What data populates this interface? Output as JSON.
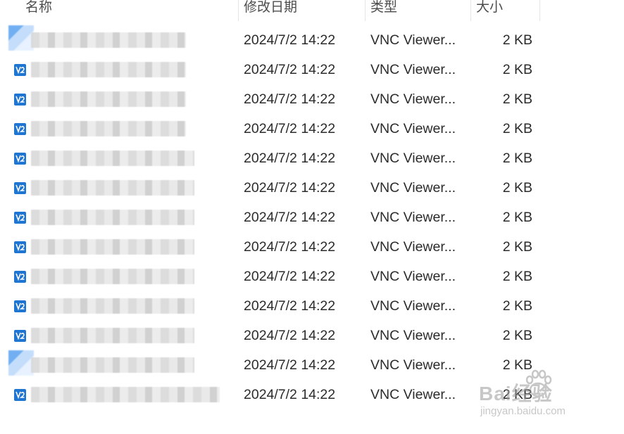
{
  "columns": {
    "name": "名称",
    "date": "修改日期",
    "type": "类型",
    "size": "大小"
  },
  "files": [
    {
      "date": "2024/7/2 14:22",
      "type": "VNC Viewer...",
      "size": "2 KB"
    },
    {
      "date": "2024/7/2 14:22",
      "type": "VNC Viewer...",
      "size": "2 KB"
    },
    {
      "date": "2024/7/2 14:22",
      "type": "VNC Viewer...",
      "size": "2 KB"
    },
    {
      "date": "2024/7/2 14:22",
      "type": "VNC Viewer...",
      "size": "2 KB"
    },
    {
      "date": "2024/7/2 14:22",
      "type": "VNC Viewer...",
      "size": "2 KB"
    },
    {
      "date": "2024/7/2 14:22",
      "type": "VNC Viewer...",
      "size": "2 KB"
    },
    {
      "date": "2024/7/2 14:22",
      "type": "VNC Viewer...",
      "size": "2 KB"
    },
    {
      "date": "2024/7/2 14:22",
      "type": "VNC Viewer...",
      "size": "2 KB"
    },
    {
      "date": "2024/7/2 14:22",
      "type": "VNC Viewer...",
      "size": "2 KB"
    },
    {
      "date": "2024/7/2 14:22",
      "type": "VNC Viewer...",
      "size": "2 KB"
    },
    {
      "date": "2024/7/2 14:22",
      "type": "VNC Viewer...",
      "size": "2 KB"
    },
    {
      "date": "2024/7/2 14:22",
      "type": "VNC Viewer...",
      "size": "2 KB"
    },
    {
      "date": "2024/7/2 14:22",
      "type": "VNC Viewer...",
      "size": "2 KB"
    }
  ],
  "file_icon": "vnc-viewer-icon",
  "watermark": {
    "main": "Bai经验",
    "sub": "jingyan.baidu.com"
  },
  "colors": {
    "icon_blue": "#1f76d2",
    "header_text": "#4c4c4c"
  }
}
